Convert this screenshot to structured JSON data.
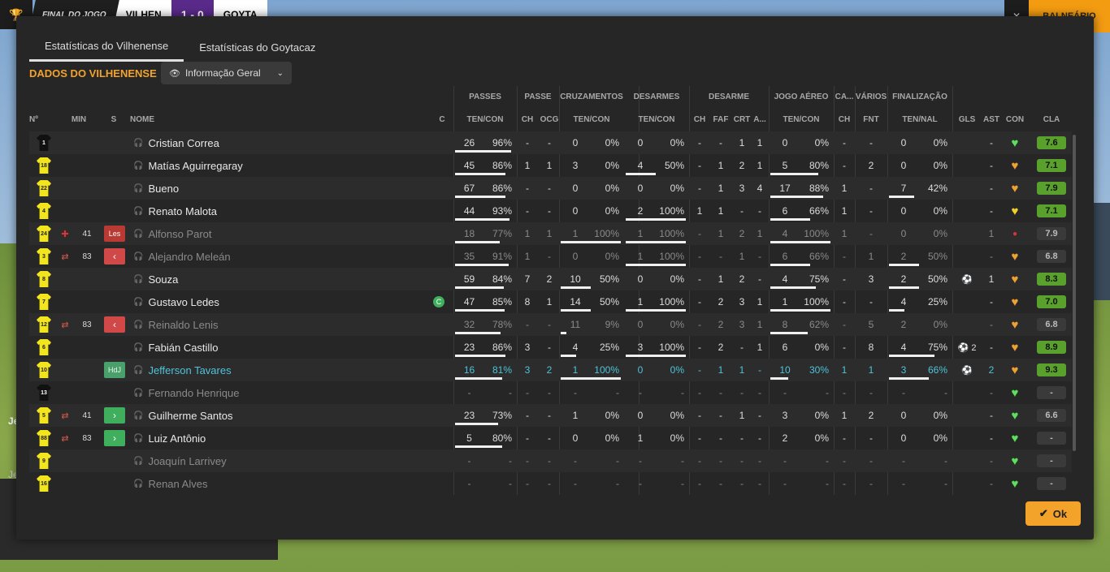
{
  "topbar": {
    "final_label": "FINAL DO JOGO",
    "home": "VILHEN",
    "score": "1 - 0",
    "away": "GOYTA",
    "balneario": "BALNEÁRIO"
  },
  "tabs": [
    "Estatísticas do Vilhenense",
    "Estatísticas do Goytacaz"
  ],
  "section_title": "DADOS DO VILHENENSE",
  "dropdown": "Informação Geral",
  "groups": [
    "PASSES",
    "PASSE",
    "CRUZAMENTOS",
    "DESARMES",
    "DESARME",
    "JOGO AÉREO",
    "CA...",
    "VÁRIOS",
    "FINALIZAÇÃO"
  ],
  "headers": [
    "Nº",
    "MIN",
    "S",
    "NOME",
    "C",
    "TEN/CON",
    "CH",
    "OCG",
    "TEN/CON",
    "TEN/CON",
    "CH",
    "FAF",
    "CRT",
    "A...",
    "TEN/CON",
    "CH",
    "FNT",
    "TEN/NAL",
    "GLS",
    "AST",
    "CON",
    "CLA"
  ],
  "ok_label": "Ok",
  "left_texts": [
    "Je",
    "Je"
  ],
  "players": [
    {
      "num": "1",
      "gk": true,
      "min": "",
      "icon": "",
      "badge": "",
      "name": "Cristian Correa",
      "cap": "",
      "p": [
        "26",
        "96%"
      ],
      "pch": "-",
      "pocg": "-",
      "cr": [
        "0",
        "0%"
      ],
      "de": [
        "0",
        "0%"
      ],
      "dch": "-",
      "faf": "-",
      "crt": "1",
      "a": "1",
      "ja": [
        "0",
        "0%"
      ],
      "ca": "-",
      "fnt": "-",
      "fi": [
        "0",
        "0%"
      ],
      "gls": "",
      "ast": "-",
      "con": "green",
      "cla": "7.6",
      "dim": false
    },
    {
      "num": "18",
      "gk": false,
      "min": "",
      "icon": "",
      "badge": "",
      "name": "Matías Aguirregaray",
      "cap": "",
      "p": [
        "45",
        "86%"
      ],
      "pch": "1",
      "pocg": "1",
      "cr": [
        "3",
        "0%"
      ],
      "de": [
        "4",
        "50%"
      ],
      "dch": "-",
      "faf": "1",
      "crt": "2",
      "a": "1",
      "ja": [
        "5",
        "80%"
      ],
      "ca": "-",
      "fnt": "2",
      "fi": [
        "0",
        "0%"
      ],
      "gls": "",
      "ast": "-",
      "con": "orange",
      "cla": "7.1",
      "dim": false
    },
    {
      "num": "22",
      "gk": false,
      "min": "",
      "icon": "",
      "badge": "",
      "name": "Bueno",
      "cap": "",
      "p": [
        "67",
        "86%"
      ],
      "pch": "-",
      "pocg": "-",
      "cr": [
        "0",
        "0%"
      ],
      "de": [
        "0",
        "0%"
      ],
      "dch": "-",
      "faf": "1",
      "crt": "3",
      "a": "4",
      "ja": [
        "17",
        "88%"
      ],
      "ca": "1",
      "fnt": "-",
      "fi": [
        "7",
        "42%"
      ],
      "gls": "",
      "ast": "-",
      "con": "orange",
      "cla": "7.9",
      "dim": false
    },
    {
      "num": "4",
      "gk": false,
      "min": "",
      "icon": "",
      "badge": "",
      "name": "Renato Malota",
      "cap": "",
      "p": [
        "44",
        "93%"
      ],
      "pch": "-",
      "pocg": "-",
      "cr": [
        "0",
        "0%"
      ],
      "de": [
        "2",
        "100%"
      ],
      "dch": "1",
      "faf": "1",
      "crt": "-",
      "a": "-",
      "ja": [
        "6",
        "66%"
      ],
      "ca": "1",
      "fnt": "-",
      "fi": [
        "0",
        "0%"
      ],
      "gls": "",
      "ast": "-",
      "con": "yellow",
      "cla": "7.1",
      "dim": false
    },
    {
      "num": "24",
      "gk": false,
      "min": "41",
      "icon": "injury",
      "badge": "Les",
      "name": "Alfonso Parot",
      "cap": "",
      "p": [
        "18",
        "77%"
      ],
      "pch": "1",
      "pocg": "1",
      "cr": [
        "1",
        "100%"
      ],
      "de": [
        "1",
        "100%"
      ],
      "dch": "-",
      "faf": "1",
      "crt": "2",
      "a": "1",
      "ja": [
        "4",
        "100%"
      ],
      "ca": "1",
      "fnt": "-",
      "fi": [
        "0",
        "0%"
      ],
      "gls": "",
      "ast": "1",
      "con": "red",
      "cla": "7.9",
      "dim": true
    },
    {
      "num": "3",
      "gk": false,
      "min": "83",
      "icon": "sub",
      "badge": "out",
      "name": "Alejandro Meleán",
      "cap": "",
      "p": [
        "35",
        "91%"
      ],
      "pch": "1",
      "pocg": "-",
      "cr": [
        "0",
        "0%"
      ],
      "de": [
        "1",
        "100%"
      ],
      "dch": "-",
      "faf": "-",
      "crt": "1",
      "a": "-",
      "ja": [
        "6",
        "66%"
      ],
      "ca": "-",
      "fnt": "1",
      "fi": [
        "2",
        "50%"
      ],
      "gls": "",
      "ast": "-",
      "con": "orange",
      "cla": "6.8",
      "dim": true
    },
    {
      "num": "8",
      "gk": false,
      "min": "",
      "icon": "",
      "badge": "",
      "name": "Souza",
      "cap": "",
      "p": [
        "59",
        "84%"
      ],
      "pch": "7",
      "pocg": "2",
      "cr": [
        "10",
        "50%"
      ],
      "de": [
        "0",
        "0%"
      ],
      "dch": "-",
      "faf": "1",
      "crt": "2",
      "a": "-",
      "ja": [
        "4",
        "75%"
      ],
      "ca": "-",
      "fnt": "3",
      "fi": [
        "2",
        "50%"
      ],
      "gls": "⚽",
      "ast": "1",
      "con": "orange",
      "cla": "8.3",
      "dim": false
    },
    {
      "num": "7",
      "gk": false,
      "min": "",
      "icon": "",
      "badge": "",
      "name": "Gustavo Ledes",
      "cap": "C",
      "p": [
        "47",
        "85%"
      ],
      "pch": "8",
      "pocg": "1",
      "cr": [
        "14",
        "50%"
      ],
      "de": [
        "1",
        "100%"
      ],
      "dch": "-",
      "faf": "2",
      "crt": "3",
      "a": "1",
      "ja": [
        "1",
        "100%"
      ],
      "ca": "-",
      "fnt": "-",
      "fi": [
        "4",
        "25%"
      ],
      "gls": "",
      "ast": "-",
      "con": "orange",
      "cla": "7.0",
      "dim": false
    },
    {
      "num": "12",
      "gk": false,
      "min": "83",
      "icon": "sub",
      "badge": "out",
      "name": "Reinaldo Lenis",
      "cap": "",
      "p": [
        "32",
        "78%"
      ],
      "pch": "-",
      "pocg": "-",
      "cr": [
        "11",
        "9%"
      ],
      "de": [
        "0",
        "0%"
      ],
      "dch": "-",
      "faf": "2",
      "crt": "3",
      "a": "1",
      "ja": [
        "8",
        "62%"
      ],
      "ca": "-",
      "fnt": "5",
      "fi": [
        "2",
        "0%"
      ],
      "gls": "",
      "ast": "-",
      "con": "orange",
      "cla": "6.8",
      "dim": true
    },
    {
      "num": "6",
      "gk": false,
      "min": "",
      "icon": "",
      "badge": "",
      "name": "Fabián Castillo",
      "cap": "",
      "p": [
        "23",
        "86%"
      ],
      "pch": "3",
      "pocg": "-",
      "cr": [
        "4",
        "25%"
      ],
      "de": [
        "3",
        "100%"
      ],
      "dch": "-",
      "faf": "2",
      "crt": "-",
      "a": "1",
      "ja": [
        "6",
        "0%"
      ],
      "ca": "-",
      "fnt": "8",
      "fi": [
        "4",
        "75%"
      ],
      "gls": "⚽ 2",
      "ast": "-",
      "con": "orange",
      "cla": "8.9",
      "dim": false
    },
    {
      "num": "10",
      "gk": false,
      "min": "",
      "icon": "",
      "badge": "HdJ",
      "name": "Jefferson Tavares",
      "cap": "",
      "p": [
        "16",
        "81%"
      ],
      "pch": "3",
      "pocg": "2",
      "cr": [
        "1",
        "100%"
      ],
      "de": [
        "0",
        "0%"
      ],
      "dch": "-",
      "faf": "1",
      "crt": "1",
      "a": "-",
      "ja": [
        "10",
        "30%"
      ],
      "ca": "1",
      "fnt": "1",
      "fi": [
        "3",
        "66%"
      ],
      "gls": "⚽",
      "ast": "2",
      "con": "orange",
      "cla": "9.3",
      "dim": false,
      "teal": true
    },
    {
      "num": "13",
      "gk": true,
      "min": "",
      "icon": "",
      "badge": "",
      "name": "Fernando Henrique",
      "cap": "",
      "p": [
        "-",
        "-"
      ],
      "pch": "-",
      "pocg": "-",
      "cr": [
        "-",
        "-"
      ],
      "de": [
        "-",
        "-"
      ],
      "dch": "-",
      "faf": "-",
      "crt": "-",
      "a": "-",
      "ja": [
        "-",
        "-"
      ],
      "ca": "-",
      "fnt": "-",
      "fi": [
        "-",
        "-"
      ],
      "gls": "",
      "ast": "-",
      "con": "green",
      "cla": "-",
      "dim": true
    },
    {
      "num": "5",
      "gk": false,
      "min": "41",
      "icon": "sub",
      "badge": "in",
      "name": "Guilherme Santos",
      "cap": "",
      "p": [
        "23",
        "73%"
      ],
      "pch": "-",
      "pocg": "-",
      "cr": [
        "1",
        "0%"
      ],
      "de": [
        "0",
        "0%"
      ],
      "dch": "-",
      "faf": "-",
      "crt": "1",
      "a": "-",
      "ja": [
        "3",
        "0%"
      ],
      "ca": "1",
      "fnt": "2",
      "fi": [
        "0",
        "0%"
      ],
      "gls": "",
      "ast": "-",
      "con": "green",
      "cla": "6.6",
      "dim": false
    },
    {
      "num": "88",
      "gk": false,
      "min": "83",
      "icon": "sub",
      "badge": "in",
      "name": "Luiz Antônio",
      "cap": "",
      "p": [
        "5",
        "80%"
      ],
      "pch": "-",
      "pocg": "-",
      "cr": [
        "0",
        "0%"
      ],
      "de": [
        "1",
        "0%"
      ],
      "dch": "-",
      "faf": "-",
      "crt": "-",
      "a": "-",
      "ja": [
        "2",
        "0%"
      ],
      "ca": "-",
      "fnt": "-",
      "fi": [
        "0",
        "0%"
      ],
      "gls": "",
      "ast": "-",
      "con": "green",
      "cla": "-",
      "dim": false
    },
    {
      "num": "9",
      "gk": false,
      "min": "",
      "icon": "",
      "badge": "",
      "name": "Joaquín Larrivey",
      "cap": "",
      "p": [
        "-",
        "-"
      ],
      "pch": "-",
      "pocg": "-",
      "cr": [
        "-",
        "-"
      ],
      "de": [
        "-",
        "-"
      ],
      "dch": "-",
      "faf": "-",
      "crt": "-",
      "a": "-",
      "ja": [
        "-",
        "-"
      ],
      "ca": "-",
      "fnt": "-",
      "fi": [
        "-",
        "-"
      ],
      "gls": "",
      "ast": "-",
      "con": "green",
      "cla": "-",
      "dim": true
    },
    {
      "num": "16",
      "gk": false,
      "min": "",
      "icon": "",
      "badge": "",
      "name": "Renan Alves",
      "cap": "",
      "p": [
        "-",
        "-"
      ],
      "pch": "-",
      "pocg": "-",
      "cr": [
        "-",
        "-"
      ],
      "de": [
        "-",
        "-"
      ],
      "dch": "-",
      "faf": "-",
      "crt": "-",
      "a": "-",
      "ja": [
        "-",
        "-"
      ],
      "ca": "-",
      "fnt": "-",
      "fi": [
        "-",
        "-"
      ],
      "gls": "",
      "ast": "-",
      "con": "green",
      "cla": "-",
      "dim": true
    }
  ],
  "colors": {
    "accent": "#f2a32c",
    "green": "#5aa02c",
    "teal": "#4fc3d9",
    "heart_green": "#5be05b",
    "heart_orange": "#f0a030",
    "heart_yellow": "#f2d02a",
    "injury_red": "#d33"
  }
}
